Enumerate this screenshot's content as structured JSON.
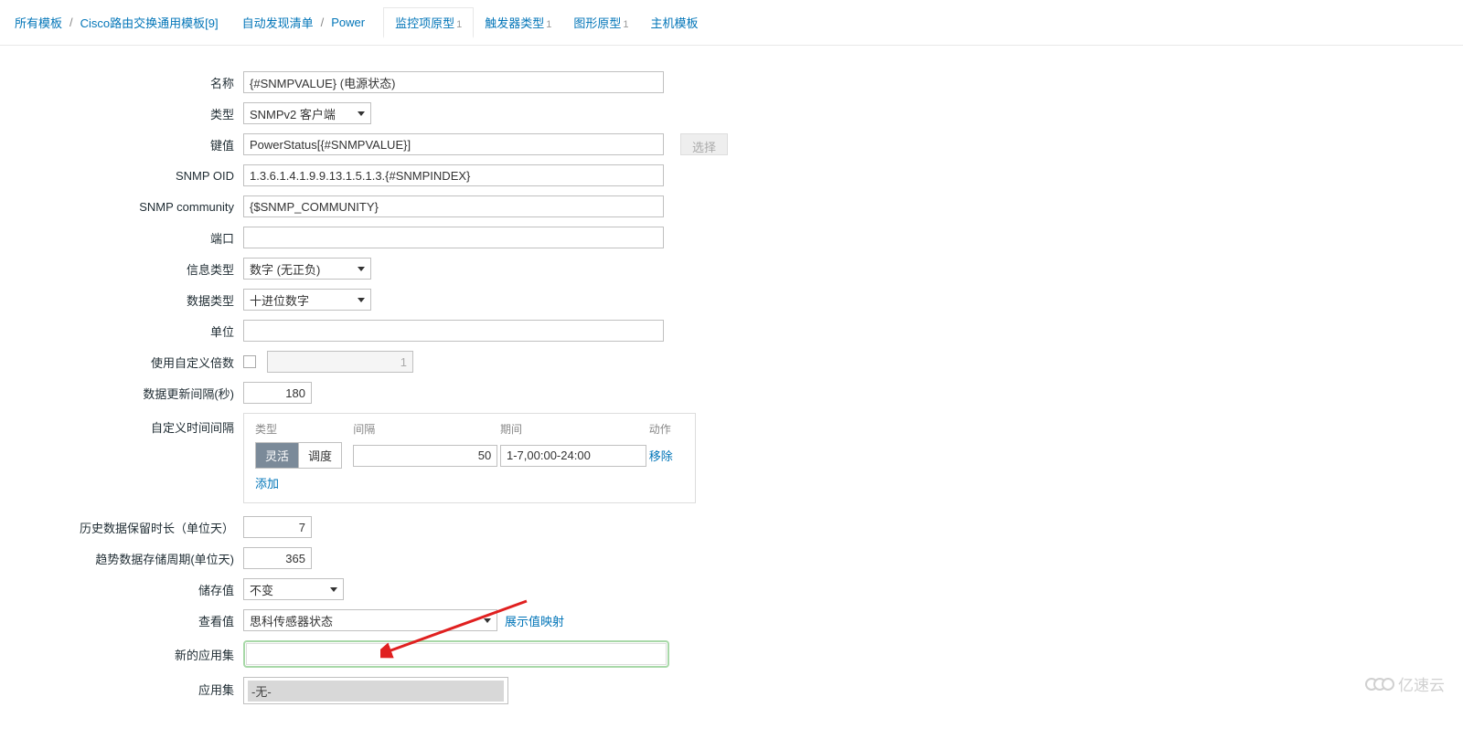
{
  "breadcrumb": {
    "all_templates": "所有模板",
    "template_name": "Cisco路由交换通用模板[9]",
    "discovery_list": "自动发现清单",
    "discovery_rule": "Power"
  },
  "tabs": {
    "item_proto": {
      "label": "监控项原型",
      "count": "1"
    },
    "trigger_proto": {
      "label": "触发器类型",
      "count": "1"
    },
    "graph_proto": {
      "label": "图形原型",
      "count": "1"
    },
    "host_proto": {
      "label": "主机模板"
    }
  },
  "labels": {
    "name": "名称",
    "type": "类型",
    "key": "键值",
    "snmp_oid": "SNMP OID",
    "snmp_community": "SNMP community",
    "port": "端口",
    "info_type": "信息类型",
    "data_type": "数据类型",
    "units": "单位",
    "custom_multiplier": "使用自定义倍数",
    "update_interval": "数据更新间隔(秒)",
    "custom_intervals": "自定义时间间隔",
    "history": "历史数据保留时长（单位天）",
    "trends": "趋势数据存储周期(单位天)",
    "store_value": "储存值",
    "show_value": "查看值",
    "new_app": "新的应用集",
    "applications": "应用集"
  },
  "values": {
    "name": "{#SNMPVALUE} (电源状态)",
    "type": "SNMPv2 客户端",
    "key": "PowerStatus[{#SNMPVALUE}]",
    "select_btn": "选择",
    "snmp_oid": "1.3.6.1.4.1.9.9.13.1.5.1.3.{#SNMPINDEX}",
    "snmp_community": "{$SNMP_COMMUNITY}",
    "port": "",
    "info_type": "数字 (无正负)",
    "data_type": "十进位数字",
    "units": "",
    "multiplier_value": "1",
    "update_interval": "180",
    "interval_headers": {
      "type": "类型",
      "interval": "间隔",
      "period": "期间",
      "action": "动作"
    },
    "toggle_flexible": "灵活",
    "toggle_scheduled": "调度",
    "interval_val": "50",
    "period_val": "1-7,00:00-24:00",
    "remove": "移除",
    "add": "添加",
    "history": "7",
    "trends": "365",
    "store_value": "不变",
    "show_value": "思科传感器状态",
    "show_value_map": "展示值映射",
    "new_app": "",
    "apps_none": "-无-"
  },
  "watermark": "亿速云"
}
